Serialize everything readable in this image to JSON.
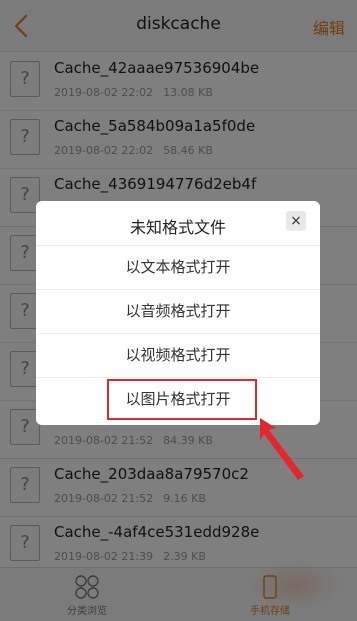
{
  "header": {
    "title": "diskcache",
    "edit_label": "编辑"
  },
  "files": [
    {
      "name": "Cache_42aaae97536904be",
      "date": "2019-08-02 22:02",
      "size": "13.08 KB"
    },
    {
      "name": "Cache_5a584b09a1a5f0de",
      "date": "2019-08-02 22:02",
      "size": "58.46 KB"
    },
    {
      "name": "Cache_4369194776d2eb4f",
      "date": "",
      "size": ""
    },
    {
      "name": "",
      "date": "",
      "size": ""
    },
    {
      "name": "",
      "date": "",
      "size": ""
    },
    {
      "name": "",
      "date": "",
      "size": ""
    },
    {
      "name": "",
      "date": "2019-08-02 21:52",
      "size": "84.39 KB"
    },
    {
      "name": "Cache_203daa8a79570c2",
      "date": "2019-08-02 21:52",
      "size": "9.16 KB"
    },
    {
      "name": "Cache_-4af4ce531edd928e",
      "date": "2019-08-02 21:39",
      "size": "2.39 KB"
    }
  ],
  "file_icon_glyph": "?",
  "tabs": {
    "browse_label": "分类浏览",
    "storage_label": "手机存储"
  },
  "dialog": {
    "title": "未知格式文件",
    "close_glyph": "×",
    "options": [
      "以文本格式打开",
      "以音频格式打开",
      "以视频格式打开",
      "以图片格式打开"
    ]
  },
  "colors": {
    "accent": "#e87a22",
    "annotation_red": "#e2282e"
  }
}
